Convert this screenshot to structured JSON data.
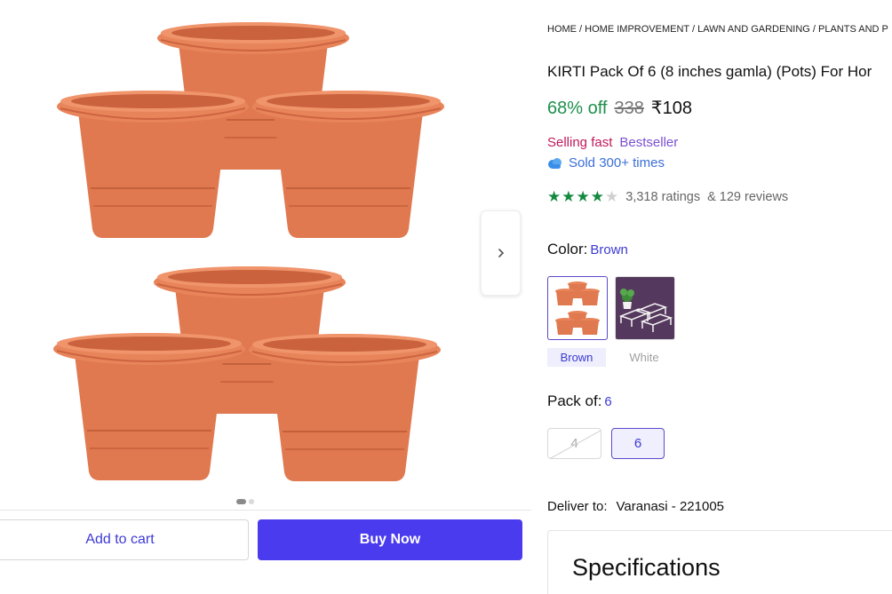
{
  "gallery": {
    "image_alt": "Six terracotta plastic flower pots",
    "carousel_dots": 2,
    "active_dot": 0,
    "pot_color": "#e07850"
  },
  "actions": {
    "add_to_cart_label": "Add to cart",
    "buy_now_label": "Buy Now"
  },
  "breadcrumb": {
    "items": [
      "HOME",
      "HOME IMPROVEMENT",
      "LAWN AND GARDENING",
      "PLANTS AND P"
    ],
    "separator": " / "
  },
  "product": {
    "title": "KIRTI Pack Of 6 (8 inches gamla) (Pots) For Hor",
    "discount": "68% off",
    "mrp": "338",
    "price": "₹108",
    "selling_fast": "Selling fast",
    "bestseller": "Bestseller",
    "sold_text": "Sold 300+ times",
    "rating": 4,
    "rating_max": 5,
    "ratings_count": "3,318 ratings",
    "reviews_count": "& 129 reviews"
  },
  "color": {
    "label": "Color:",
    "selected": "Brown",
    "options": [
      {
        "name": "Brown",
        "available": true,
        "selected": true
      },
      {
        "name": "White",
        "available": false,
        "selected": false
      }
    ]
  },
  "pack": {
    "label": "Pack of:",
    "selected": "6",
    "options": [
      {
        "value": "4",
        "available": false
      },
      {
        "value": "6",
        "available": true,
        "selected": true
      }
    ]
  },
  "delivery": {
    "label": "Deliver to:",
    "location": "Varanasi - 221005"
  },
  "specifications": {
    "title": "Specifications"
  },
  "colors": {
    "accent": "#4b3bef",
    "discount_green": "#1e8f4b",
    "star_green": "#138a3f",
    "selling_fast": "#c2185b",
    "bestseller": "#7b4fd2"
  }
}
